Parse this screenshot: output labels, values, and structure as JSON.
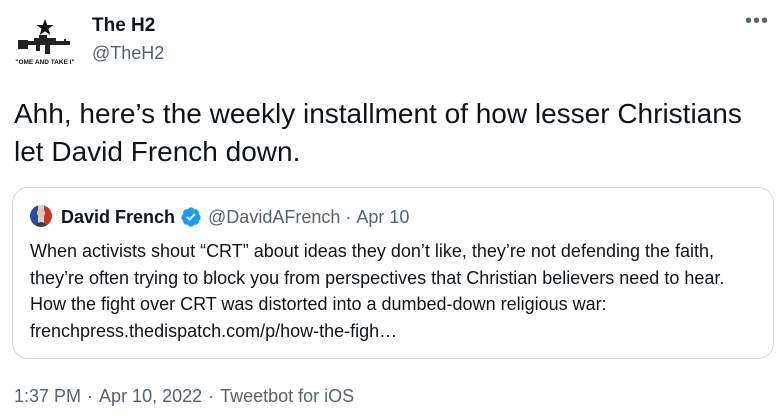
{
  "tweet": {
    "author": {
      "name": "The H2",
      "handle": "@TheH2",
      "avatar_icon": "rifle-star-come-and-take-it-icon",
      "avatar_text": "\"OME AND TAKE I\""
    },
    "more_icon": "more-options-icon",
    "text": "Ahh, here’s the weekly installment of how lesser Christians let David French down.",
    "quote": {
      "author_name": "David French",
      "verified_icon": "verified-badge-icon",
      "handle": "@DavidAFrench",
      "separator": "·",
      "date": "Apr 10",
      "text": "When activists shout “CRT” about ideas they don’t like, they’re not defending the faith, they’re often trying to block you from perspectives that Christian believers need to hear. How the fight over CRT was distorted into a dumbed-down religious war: frenchpress.thedispatch.com/p/how-the-figh…"
    },
    "meta": {
      "time": "1:37 PM",
      "separator": "·",
      "date": "Apr 10, 2022",
      "source": "Tweetbot for iOS"
    }
  },
  "colors": {
    "text_primary": "#0f1419",
    "text_secondary": "#536471",
    "border": "#cfd9de",
    "verified_blue": "#1d9bf0"
  }
}
